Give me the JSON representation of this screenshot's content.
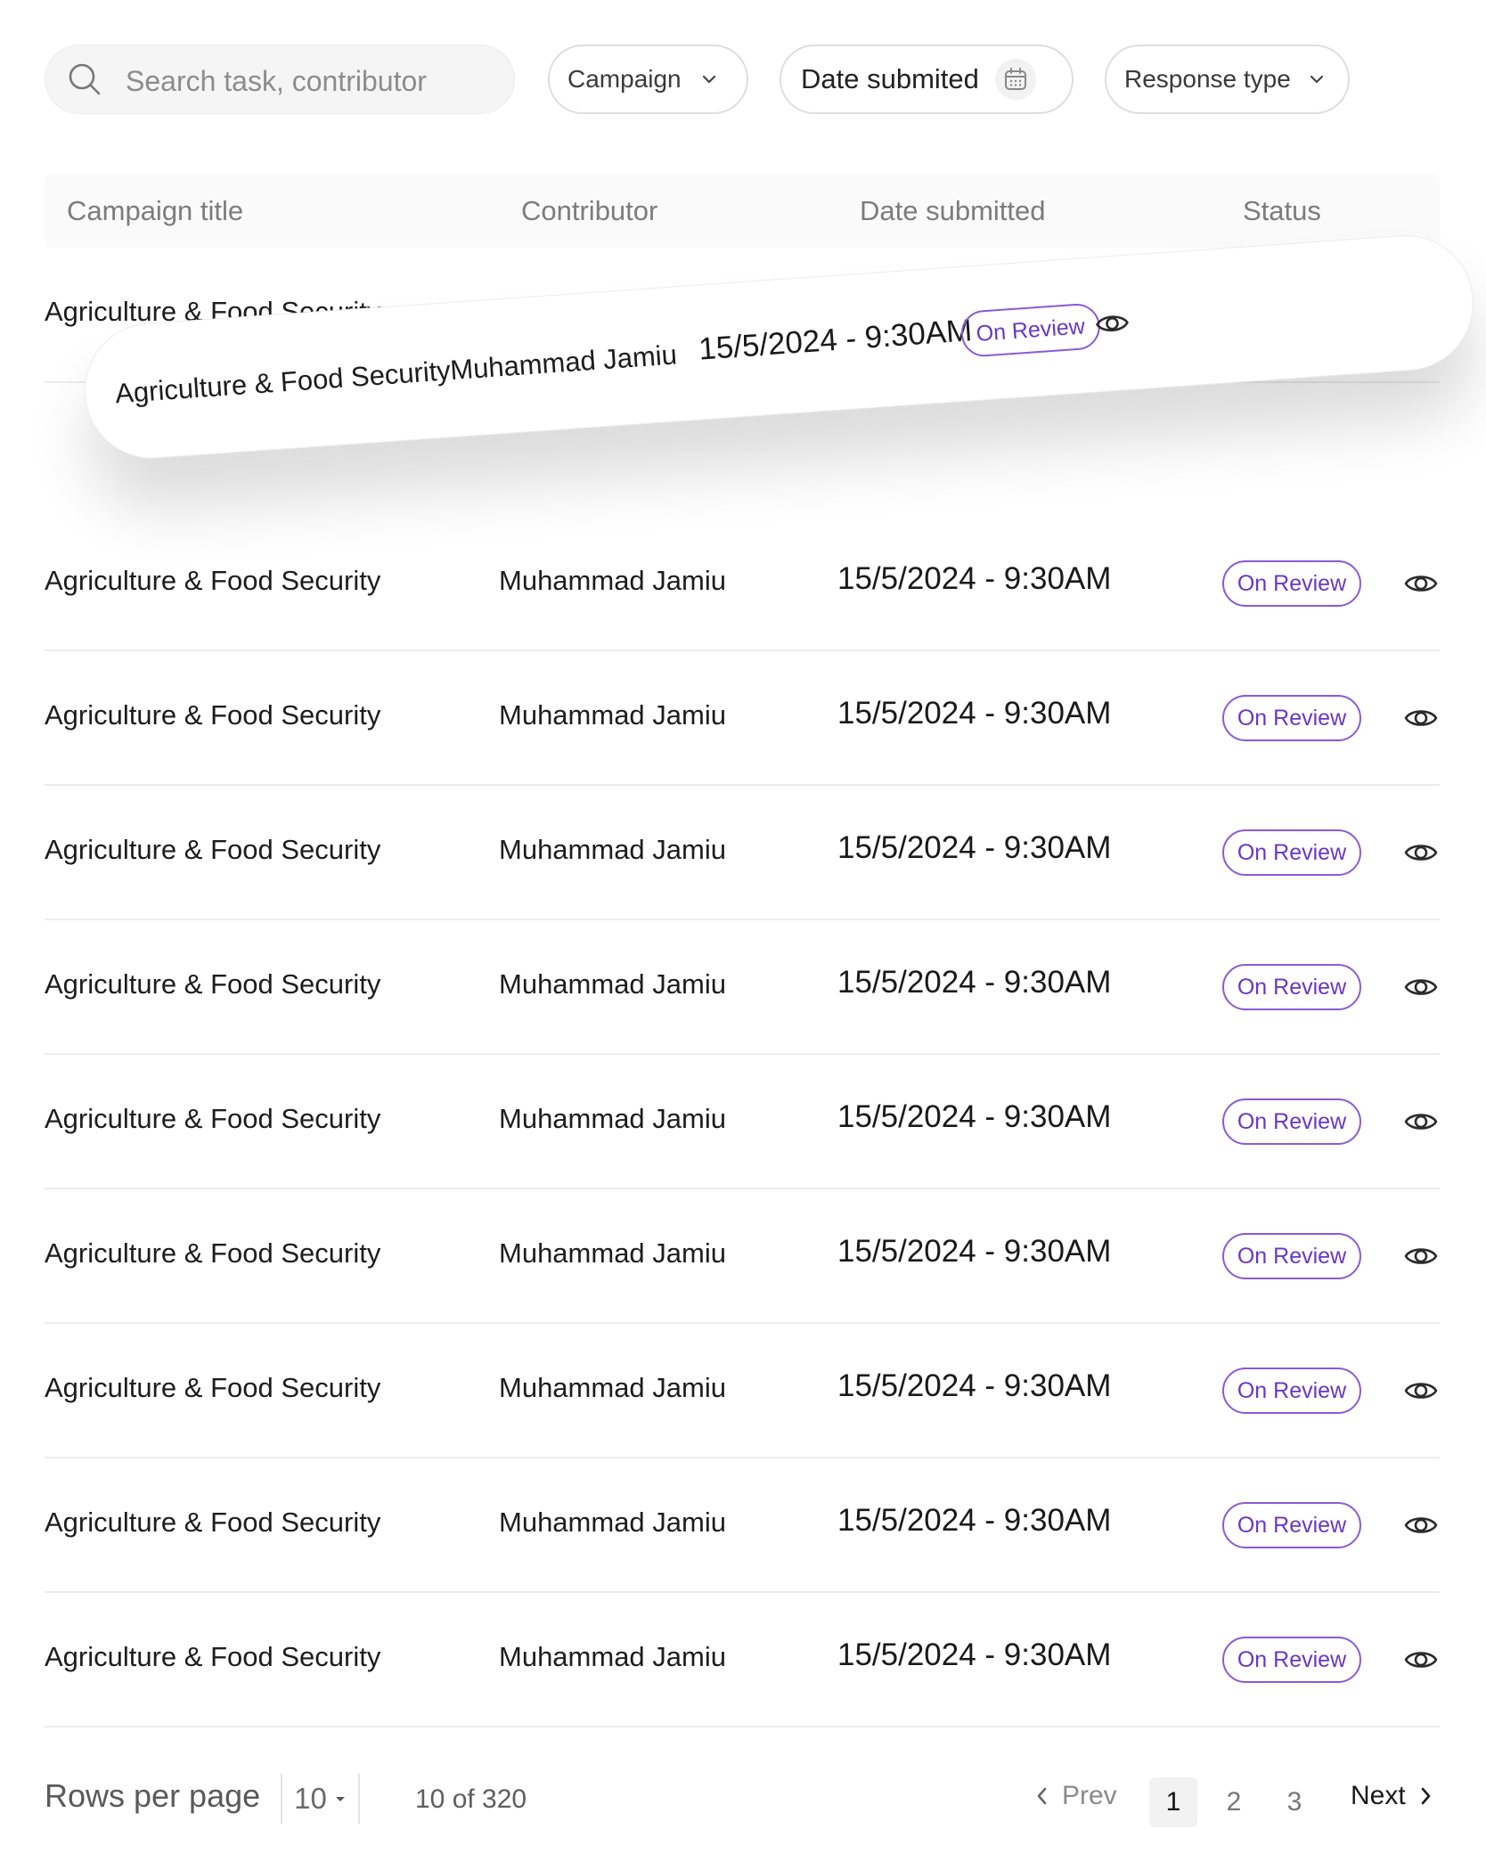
{
  "filters": {
    "search_placeholder": "Search task, contributor",
    "campaign_label": "Campaign",
    "date_label": "Date submited",
    "response_label": "Response type"
  },
  "table": {
    "headers": {
      "campaign_title": "Campaign title",
      "contributor": "Contributor",
      "date_submitted": "Date submitted",
      "status": "Status"
    },
    "dragged_row": {
      "campaign": "Agriculture & Food Security",
      "contributor": "Muhammad Jamiu",
      "date": "15/5/2024 - 9:30AM",
      "status": "On Review"
    },
    "rows": [
      {
        "campaign": "Agriculture & Food Security",
        "contributor": "Muhammad Jamiu",
        "date": "15/5/2024 - 9:30AM",
        "status": "On Review"
      },
      {
        "campaign": "Agriculture & Food Security",
        "contributor": "Muhammad Jamiu",
        "date": "15/5/2024 - 9:30AM",
        "status": "On Review"
      },
      {
        "campaign": "Agriculture & Food Security",
        "contributor": "Muhammad Jamiu",
        "date": "15/5/2024 - 9:30AM",
        "status": "On Review"
      },
      {
        "campaign": "Agriculture & Food Security",
        "contributor": "Muhammad Jamiu",
        "date": "15/5/2024 - 9:30AM",
        "status": "On Review"
      },
      {
        "campaign": "Agriculture & Food Security",
        "contributor": "Muhammad Jamiu",
        "date": "15/5/2024 - 9:30AM",
        "status": "On Review"
      },
      {
        "campaign": "Agriculture & Food Security",
        "contributor": "Muhammad Jamiu",
        "date": "15/5/2024 - 9:30AM",
        "status": "On Review"
      },
      {
        "campaign": "Agriculture & Food Security",
        "contributor": "Muhammad Jamiu",
        "date": "15/5/2024 - 9:30AM",
        "status": "On Review"
      },
      {
        "campaign": "Agriculture & Food Security",
        "contributor": "Muhammad Jamiu",
        "date": "15/5/2024 - 9:30AM",
        "status": "On Review"
      },
      {
        "campaign": "Agriculture & Food Security",
        "contributor": "Muhammad Jamiu",
        "date": "15/5/2024 - 9:30AM",
        "status": "On Review"
      },
      {
        "campaign": "Agriculture & Food Security",
        "contributor": "Muhammad Jamiu",
        "date": "15/5/2024 - 9:30AM",
        "status": "On Review"
      }
    ]
  },
  "pagination": {
    "rows_per_page_label": "Rows per page",
    "rows_per_page_value": "10",
    "range_text": "10 of 320",
    "prev_label": "Prev",
    "next_label": "Next",
    "pages": [
      "1",
      "2",
      "3"
    ],
    "current_page": "1"
  },
  "colors": {
    "status_border": "#8a5bd6",
    "status_text": "#6a37c4"
  },
  "icons": {
    "search": "search-icon",
    "chevron": "chevron-down-icon",
    "calendar": "calendar-icon",
    "view": "eye-icon",
    "prev": "chevron-left-icon",
    "next": "chevron-right-icon",
    "caret": "caret-down-icon"
  }
}
